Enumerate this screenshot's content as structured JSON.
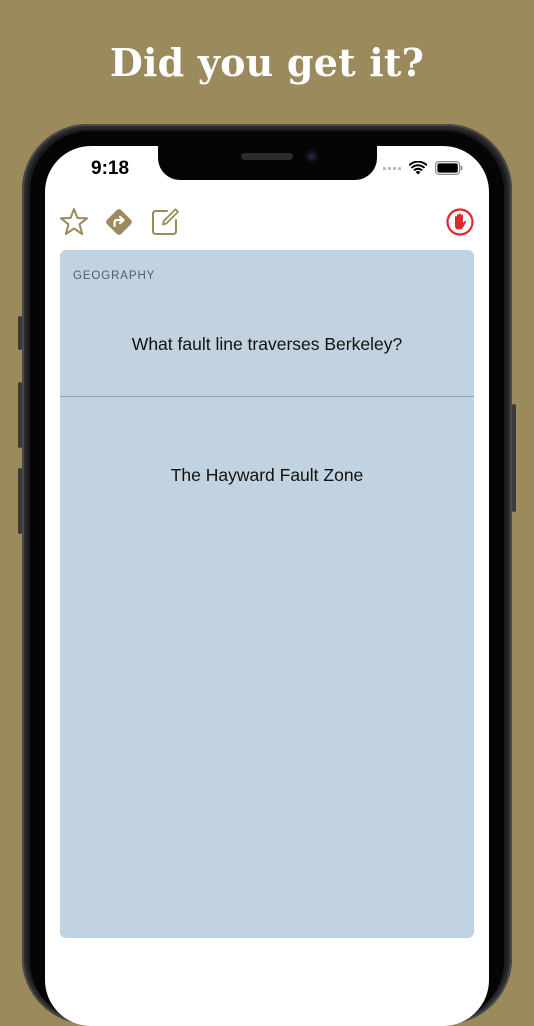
{
  "headline": "Did you get it?",
  "status_bar": {
    "time": "9:18"
  },
  "toolbar": {
    "favorite_icon": "star-outline-icon",
    "skip_icon": "forward-diamond-icon",
    "edit_icon": "compose-icon",
    "stop_icon": "hand-stop-icon"
  },
  "card": {
    "category": "GEOGRAPHY",
    "question": "What fault line traverses Berkeley?",
    "answer": "The Hayward Fault Zone"
  },
  "colors": {
    "background": "#9b8a5c",
    "accent_gold": "#9b8a5c",
    "card_bg": "#c1d3e0",
    "stop_red": "#e0292f"
  }
}
